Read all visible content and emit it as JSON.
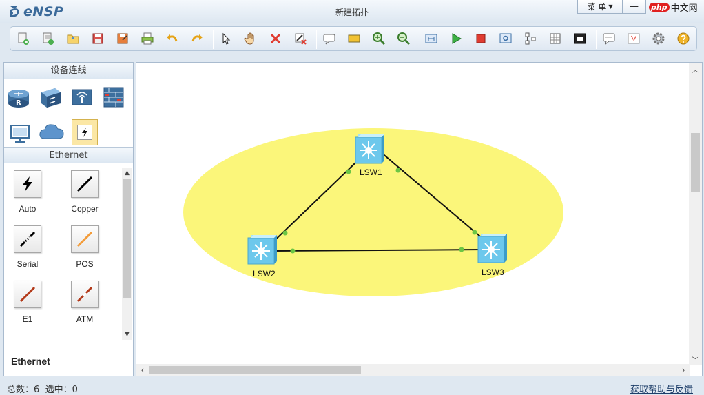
{
  "app": {
    "name": "eNSP",
    "window_title": "新建拓扑"
  },
  "window_controls": {
    "menu_label": "菜 单",
    "minimize": "—"
  },
  "brand_badge": {
    "php": "php",
    "cn": "中文网"
  },
  "toolbar": {
    "icons": [
      "new-topology-icon",
      "new-example-icon",
      "open-icon",
      "save-icon",
      "save-as-icon",
      "print-icon",
      "undo-icon",
      "redo-icon",
      "select-icon",
      "pan-hand-icon",
      "delete-icon",
      "delete-all-links-icon",
      "text-note-icon",
      "palette-icon",
      "zoom-in-icon",
      "zoom-out-icon",
      "fit-window-icon",
      "start-device-icon",
      "stop-device-icon",
      "capture-icon",
      "topology-icon",
      "grid-icon",
      "screenshot-icon",
      "forum-icon",
      "huawei-icon",
      "settings-icon",
      "help-icon"
    ]
  },
  "left_panel": {
    "device_section_title": "设备连线",
    "cable_section_title": "Ethernet",
    "cables": [
      {
        "label": "Auto",
        "icon": "auto-cable-icon",
        "color": "#000000"
      },
      {
        "label": "Copper",
        "icon": "copper-cable-icon",
        "color": "#000000"
      },
      {
        "label": "Serial",
        "icon": "serial-cable-icon",
        "color": "#000000"
      },
      {
        "label": "POS",
        "icon": "pos-cable-icon",
        "color": "#f39c3a"
      },
      {
        "label": "E1",
        "icon": "e1-cable-icon",
        "color": "#b33a1a"
      },
      {
        "label": "ATM",
        "icon": "atm-cable-icon",
        "color": "#b33a1a"
      }
    ],
    "selected_category": "Ethernet"
  },
  "topology": {
    "area_color": "#fbf67a",
    "nodes": [
      {
        "id": "LSW1",
        "label": "LSW1"
      },
      {
        "id": "LSW2",
        "label": "LSW2"
      },
      {
        "id": "LSW3",
        "label": "LSW3"
      }
    ],
    "links": [
      [
        "LSW1",
        "LSW2"
      ],
      [
        "LSW1",
        "LSW3"
      ],
      [
        "LSW2",
        "LSW3"
      ]
    ],
    "port_color": "#6cc644"
  },
  "statusbar": {
    "total_label": "总数：",
    "total": "6",
    "selected_label": "选中：",
    "selected": "0",
    "help_link": "获取帮助与反馈"
  }
}
